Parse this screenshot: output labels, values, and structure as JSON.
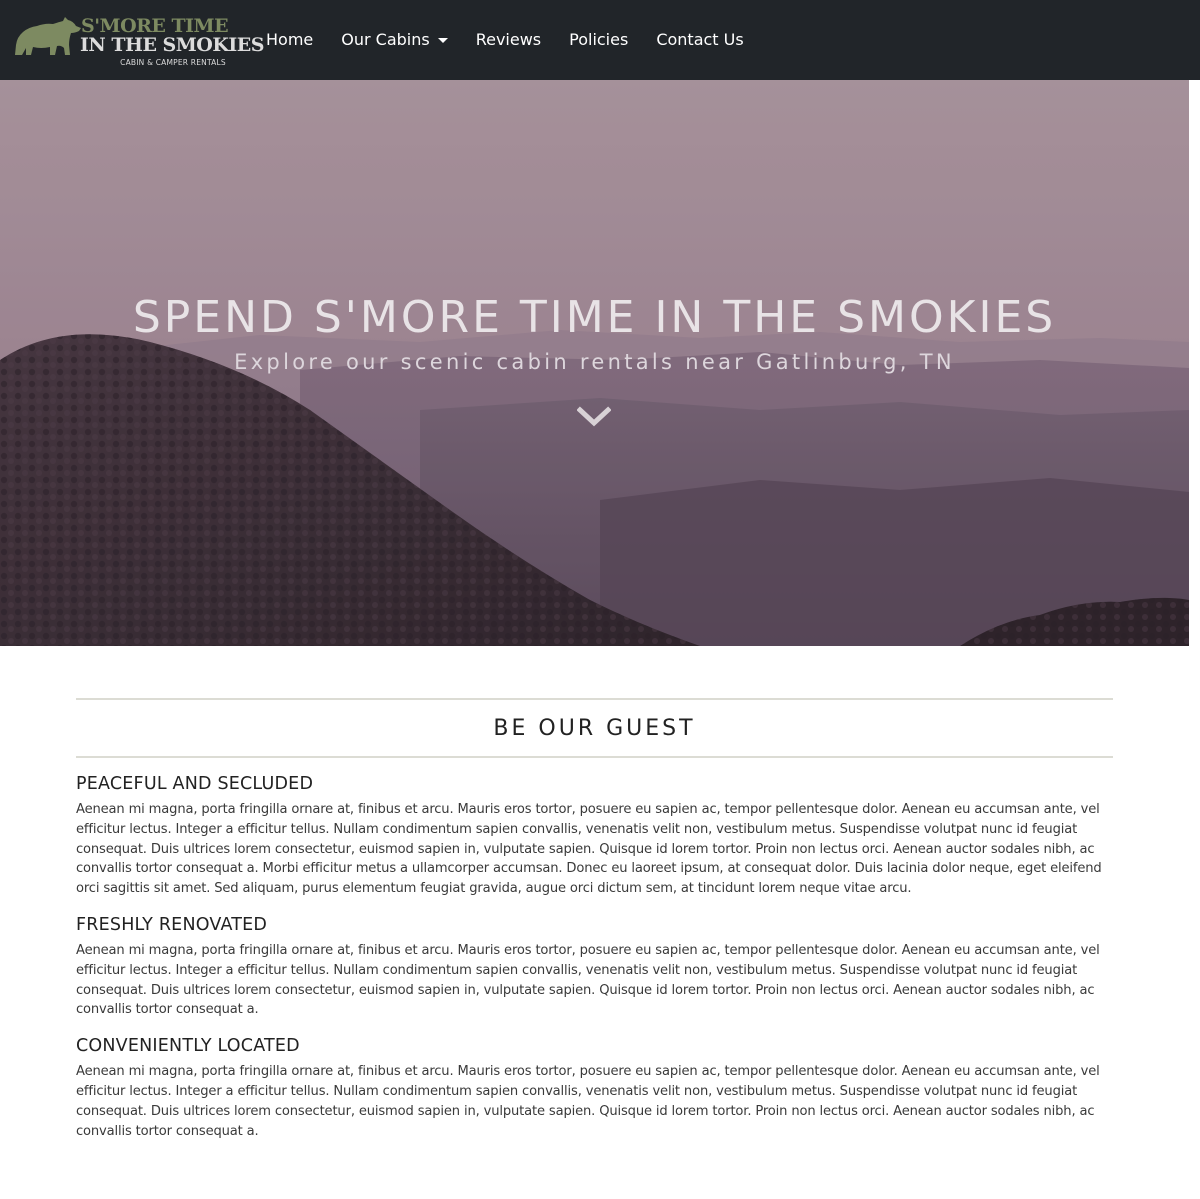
{
  "brand": {
    "line1": "S'MORE TIME",
    "line2": "IN THE SMOKIES",
    "line3": "CABIN & CAMPER RENTALS",
    "bear_color": "#7d8a61"
  },
  "nav": {
    "items": [
      {
        "label": "Home"
      },
      {
        "label": "Our Cabins"
      },
      {
        "label": "Reviews"
      },
      {
        "label": "Policies"
      },
      {
        "label": "Contact Us"
      }
    ]
  },
  "hero": {
    "title": "SPEND S'MORE TIME IN THE SMOKIES",
    "subtitle": "Explore our scenic cabin rentals near Gatlinburg, TN",
    "icon": "chevron-down-icon"
  },
  "main": {
    "section_title": "BE OUR GUEST",
    "features": [
      {
        "heading": "PEACEFUL AND SECLUDED",
        "text": "Aenean mi magna, porta fringilla ornare at, finibus et arcu. Mauris eros tortor, posuere eu sapien ac, tempor pellentesque dolor. Aenean eu accumsan ante, vel efficitur lectus. Integer a efficitur tellus. Nullam condimentum sapien convallis, venenatis velit non, vestibulum metus. Suspendisse volutpat nunc id feugiat consequat. Duis ultrices lorem consectetur, euismod sapien in, vulputate sapien. Quisque id lorem tortor. Proin non lectus orci. Aenean auctor sodales nibh, ac convallis tortor consequat a. Morbi efficitur metus a ullamcorper accumsan. Donec eu laoreet ipsum, at consequat dolor. Duis lacinia dolor neque, eget eleifend orci sagittis sit amet. Sed aliquam, purus elementum feugiat gravida, augue orci dictum sem, at tincidunt lorem neque vitae arcu."
      },
      {
        "heading": "FRESHLY RENOVATED",
        "text": "Aenean mi magna, porta fringilla ornare at, finibus et arcu. Mauris eros tortor, posuere eu sapien ac, tempor pellentesque dolor. Aenean eu accumsan ante, vel efficitur lectus. Integer a efficitur tellus. Nullam condimentum sapien convallis, venenatis velit non, vestibulum metus. Suspendisse volutpat nunc id feugiat consequat. Duis ultrices lorem consectetur, euismod sapien in, vulputate sapien. Quisque id lorem tortor. Proin non lectus orci. Aenean auctor sodales nibh, ac convallis tortor consequat a."
      },
      {
        "heading": "CONVENIENTLY LOCATED",
        "text": "Aenean mi magna, porta fringilla ornare at, finibus et arcu. Mauris eros tortor, posuere eu sapien ac, tempor pellentesque dolor. Aenean eu accumsan ante, vel efficitur lectus. Integer a efficitur tellus. Nullam condimentum sapien convallis, venenatis velit non, vestibulum metus. Suspendisse volutpat nunc id feugiat consequat. Duis ultrices lorem consectetur, euismod sapien in, vulputate sapien. Quisque id lorem tortor. Proin non lectus orci. Aenean auctor sodales nibh, ac convallis tortor consequat a."
      }
    ]
  },
  "colors": {
    "navbar_bg": "#212529",
    "hero_sky_top": "#b8a2ac",
    "hero_forest": "#3a2e35"
  }
}
